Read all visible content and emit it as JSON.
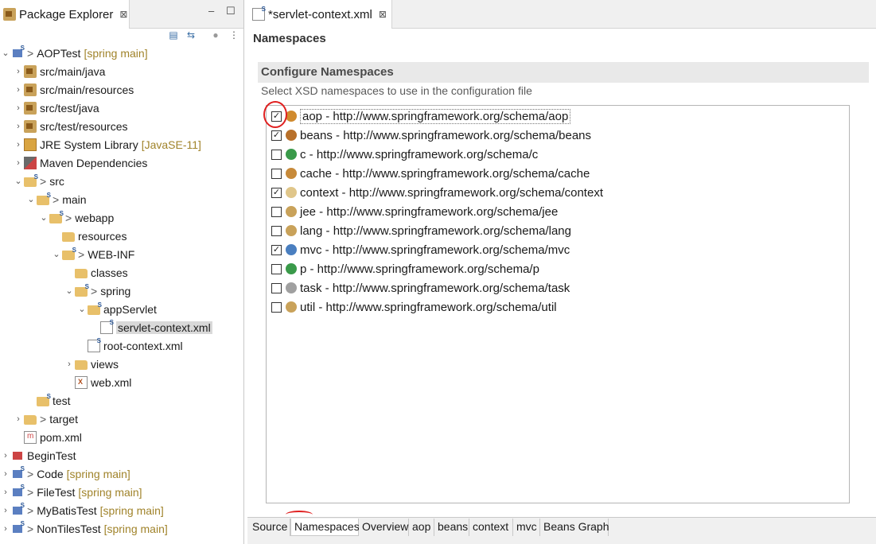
{
  "package_explorer": {
    "title": "Package Explorer",
    "close_glyph": "⊠",
    "minimize_glyph": "–",
    "maximize_glyph": "☐",
    "toolbar": [
      "collapse-all-icon",
      "link-with-editor-icon",
      "focus-icon",
      "view-menu-icon"
    ],
    "tree": [
      {
        "depth": 0,
        "arrow": "v",
        "icon": "project",
        "label": "AOPTest",
        "prefix": ">",
        "decoration": "[spring main]"
      },
      {
        "depth": 1,
        "arrow": ">",
        "icon": "pkgroot",
        "label": "src/main/java",
        "prefix": "",
        "decoration": ""
      },
      {
        "depth": 1,
        "arrow": ">",
        "icon": "pkgroot",
        "label": "src/main/resources",
        "prefix": "",
        "decoration": ""
      },
      {
        "depth": 1,
        "arrow": ">",
        "icon": "pkgroot",
        "label": "src/test/java",
        "prefix": "",
        "decoration": ""
      },
      {
        "depth": 1,
        "arrow": ">",
        "icon": "pkgroot",
        "label": "src/test/resources",
        "prefix": "",
        "decoration": ""
      },
      {
        "depth": 1,
        "arrow": ">",
        "icon": "jre",
        "label": "JRE System Library",
        "prefix": "",
        "decoration": "[JavaSE-11]"
      },
      {
        "depth": 1,
        "arrow": ">",
        "icon": "maven",
        "label": "Maven Dependencies",
        "prefix": "",
        "decoration": ""
      },
      {
        "depth": 1,
        "arrow": "v",
        "icon": "folder-s",
        "label": "src",
        "prefix": ">",
        "decoration": ""
      },
      {
        "depth": 2,
        "arrow": "v",
        "icon": "folder-s",
        "label": "main",
        "prefix": ">",
        "decoration": ""
      },
      {
        "depth": 3,
        "arrow": "v",
        "icon": "folder-s",
        "label": "webapp",
        "prefix": ">",
        "decoration": ""
      },
      {
        "depth": 4,
        "arrow": "",
        "icon": "folder",
        "label": "resources",
        "prefix": "",
        "decoration": ""
      },
      {
        "depth": 4,
        "arrow": "v",
        "icon": "folder-s",
        "label": "WEB-INF",
        "prefix": ">",
        "decoration": ""
      },
      {
        "depth": 5,
        "arrow": "",
        "icon": "folder",
        "label": "classes",
        "prefix": "",
        "decoration": ""
      },
      {
        "depth": 5,
        "arrow": "v",
        "icon": "folder-s",
        "label": "spring",
        "prefix": ">",
        "decoration": ""
      },
      {
        "depth": 6,
        "arrow": "v",
        "icon": "folder-s",
        "label": "appServlet",
        "prefix": "",
        "decoration": ""
      },
      {
        "depth": 7,
        "arrow": "",
        "icon": "xml-s",
        "label": "servlet-context.xml",
        "prefix": "",
        "decoration": "",
        "selected": true
      },
      {
        "depth": 6,
        "arrow": "",
        "icon": "xml-s",
        "label": "root-context.xml",
        "prefix": "",
        "decoration": ""
      },
      {
        "depth": 5,
        "arrow": ">",
        "icon": "folder",
        "label": "views",
        "prefix": "",
        "decoration": ""
      },
      {
        "depth": 5,
        "arrow": "",
        "icon": "xml",
        "label": "web.xml",
        "prefix": "",
        "decoration": ""
      },
      {
        "depth": 2,
        "arrow": "",
        "icon": "folder-s",
        "label": "test",
        "prefix": "",
        "decoration": ""
      },
      {
        "depth": 1,
        "arrow": ">",
        "icon": "folder",
        "label": "target",
        "prefix": ">",
        "decoration": ""
      },
      {
        "depth": 1,
        "arrow": "",
        "icon": "pom",
        "label": "pom.xml",
        "prefix": "",
        "decoration": ""
      },
      {
        "depth": 0,
        "arrow": ">",
        "icon": "project-err",
        "label": "BeginTest",
        "prefix": "",
        "decoration": ""
      },
      {
        "depth": 0,
        "arrow": ">",
        "icon": "project",
        "label": "Code",
        "prefix": ">",
        "decoration": "[spring main]"
      },
      {
        "depth": 0,
        "arrow": ">",
        "icon": "project",
        "label": "FileTest",
        "prefix": ">",
        "decoration": "[spring main]"
      },
      {
        "depth": 0,
        "arrow": ">",
        "icon": "project",
        "label": "MyBatisTest",
        "prefix": ">",
        "decoration": "[spring main]"
      },
      {
        "depth": 0,
        "arrow": ">",
        "icon": "project",
        "label": "NonTilesTest",
        "prefix": ">",
        "decoration": "[spring main]"
      }
    ]
  },
  "editor": {
    "tab_label": "*servlet-context.xml",
    "close_glyph": "⊠",
    "page_title": "Namespaces",
    "section_title": "Configure Namespaces",
    "section_desc": "Select XSD namespaces to use in the configuration file",
    "namespaces": [
      {
        "label": "aop - http://www.springframework.org/schema/aop",
        "checked": true,
        "icon_color": "#d08a2e",
        "focused": true
      },
      {
        "label": "beans - http://www.springframework.org/schema/beans",
        "checked": true,
        "icon_color": "#b8702a"
      },
      {
        "label": "c - http://www.springframework.org/schema/c",
        "checked": false,
        "icon_color": "#3a9a4a"
      },
      {
        "label": "cache - http://www.springframework.org/schema/cache",
        "checked": false,
        "icon_color": "#c78a3a"
      },
      {
        "label": "context - http://www.springframework.org/schema/context",
        "checked": true,
        "icon_color": "#e0c68a"
      },
      {
        "label": "jee - http://www.springframework.org/schema/jee",
        "checked": false,
        "icon_color": "#c9a25a"
      },
      {
        "label": "lang - http://www.springframework.org/schema/lang",
        "checked": false,
        "icon_color": "#c9a25a"
      },
      {
        "label": "mvc - http://www.springframework.org/schema/mvc",
        "checked": true,
        "icon_color": "#4a7fc0"
      },
      {
        "label": "p - http://www.springframework.org/schema/p",
        "checked": false,
        "icon_color": "#3a9a4a"
      },
      {
        "label": "task - http://www.springframework.org/schema/task",
        "checked": false,
        "icon_color": "#a0a0a0"
      },
      {
        "label": "util - http://www.springframework.org/schema/util",
        "checked": false,
        "icon_color": "#c9a25a"
      }
    ],
    "bottom_tabs": [
      "Source",
      "Namespaces",
      "Overview",
      "aop",
      "beans",
      "context",
      "mvc",
      "Beans Graph"
    ],
    "active_bottom_tab": "Namespaces"
  }
}
